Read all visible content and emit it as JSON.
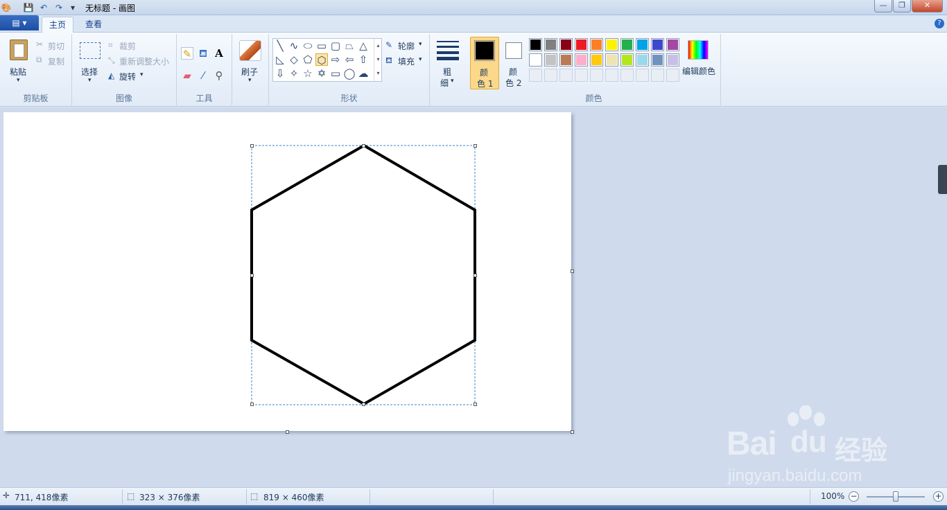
{
  "window": {
    "title": "无标题 - 画图",
    "minimize": "—",
    "maximize": "❐",
    "close": "✕"
  },
  "quick_access": {
    "save": "💾",
    "undo": "↶",
    "redo": "↷",
    "customize": "▾"
  },
  "tabs": {
    "app_menu": "▤ ▾",
    "home": "主页",
    "view": "查看",
    "help": "?"
  },
  "clipboard": {
    "paste": "粘贴",
    "cut": "剪切",
    "copy": "复制",
    "group": "剪贴板"
  },
  "image": {
    "select": "选择",
    "crop": "裁剪",
    "resize": "重新调整大小",
    "rotate": "旋转",
    "group": "图像"
  },
  "tools": {
    "group": "工具",
    "text_icon": "A"
  },
  "brushes": {
    "label": "刷子"
  },
  "shapes": {
    "outline": "轮廓",
    "fill": "填充",
    "group": "形状"
  },
  "size": {
    "label_top": "粗",
    "label_bottom": "细"
  },
  "colors": {
    "color1_top": "颜",
    "color1_bottom": "色 1",
    "color2_top": "颜",
    "color2_bottom": "色 2",
    "edit_colors": "编辑颜色",
    "group": "颜色",
    "color1_value": "#000000",
    "color2_value": "#ffffff",
    "palette_row1": [
      "#000000",
      "#7f7f7f",
      "#880015",
      "#ed1c24",
      "#ff7f27",
      "#fff200",
      "#22b14c",
      "#00a2e8",
      "#3f48cc",
      "#a349a4"
    ],
    "palette_row2": [
      "#ffffff",
      "#c3c3c3",
      "#b97a57",
      "#ffaec9",
      "#ffc90e",
      "#efe4b0",
      "#b5e61d",
      "#99d9ea",
      "#7092be",
      "#c8bfe7"
    ]
  },
  "status": {
    "cursor_pos": "711, 418像素",
    "selection_size": "323 × 376像素",
    "image_size": "819 × 460像素",
    "zoom": "100%",
    "zoom_out": "−",
    "zoom_in": "+"
  },
  "watermark": {
    "brand": "Bai",
    "brand2": "du",
    "brand_cn": "经验",
    "url": "jingyan.baidu.com"
  }
}
